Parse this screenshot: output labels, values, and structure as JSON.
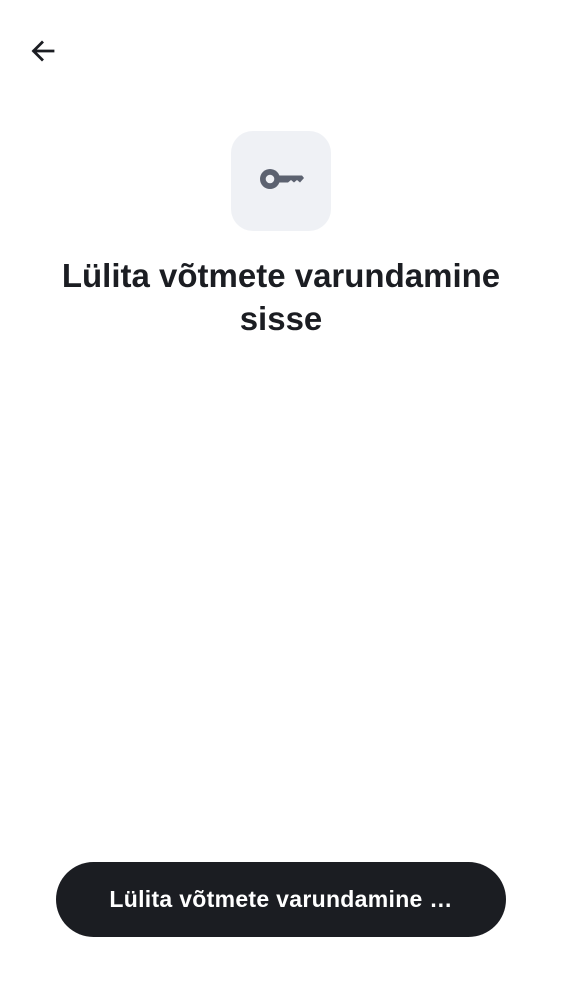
{
  "header": {
    "back_icon": "arrow-left-icon"
  },
  "hero": {
    "icon": "key-icon",
    "icon_background": "#eff1f5",
    "icon_color": "#5c6270"
  },
  "title": "Lülita võtmete varundamine sisse",
  "primary_button": {
    "label": "Lülita võtmete varundamine …",
    "background": "#1b1d22",
    "text_color": "#ffffff"
  }
}
